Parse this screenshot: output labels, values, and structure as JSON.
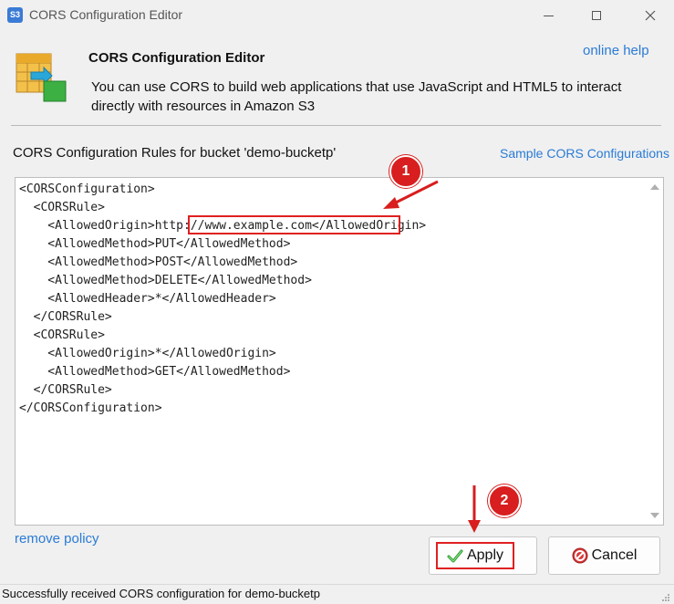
{
  "window": {
    "app_icon_text": "S3",
    "title": "CORS Configuration Editor"
  },
  "header": {
    "title": "CORS Configuration Editor",
    "description": "You can use CORS to build web applications that use JavaScript and HTML5 to interact directly with resources in Amazon S3",
    "online_help_label": "online help"
  },
  "rules": {
    "label": "CORS Configuration Rules for bucket 'demo-bucketp'",
    "sample_link": "Sample CORS Configurations",
    "xml": "<CORSConfiguration>\n  <CORSRule>\n    <AllowedOrigin>http://www.example.com</AllowedOrigin>\n    <AllowedMethod>PUT</AllowedMethod>\n    <AllowedMethod>POST</AllowedMethod>\n    <AllowedMethod>DELETE</AllowedMethod>\n    <AllowedHeader>*</AllowedHeader>\n  </CORSRule>\n  <CORSRule>\n    <AllowedOrigin>*</AllowedOrigin>\n    <AllowedMethod>GET</AllowedMethod>\n  </CORSRule>\n</CORSConfiguration>"
  },
  "annotations": {
    "step1": "1",
    "step2": "2",
    "accent_color": "#d81e1e"
  },
  "footer": {
    "remove_policy_label": "remove policy",
    "apply_label": "Apply",
    "cancel_label": "Cancel"
  },
  "status": {
    "text": "Successfully received CORS configuration for demo-bucketp"
  }
}
